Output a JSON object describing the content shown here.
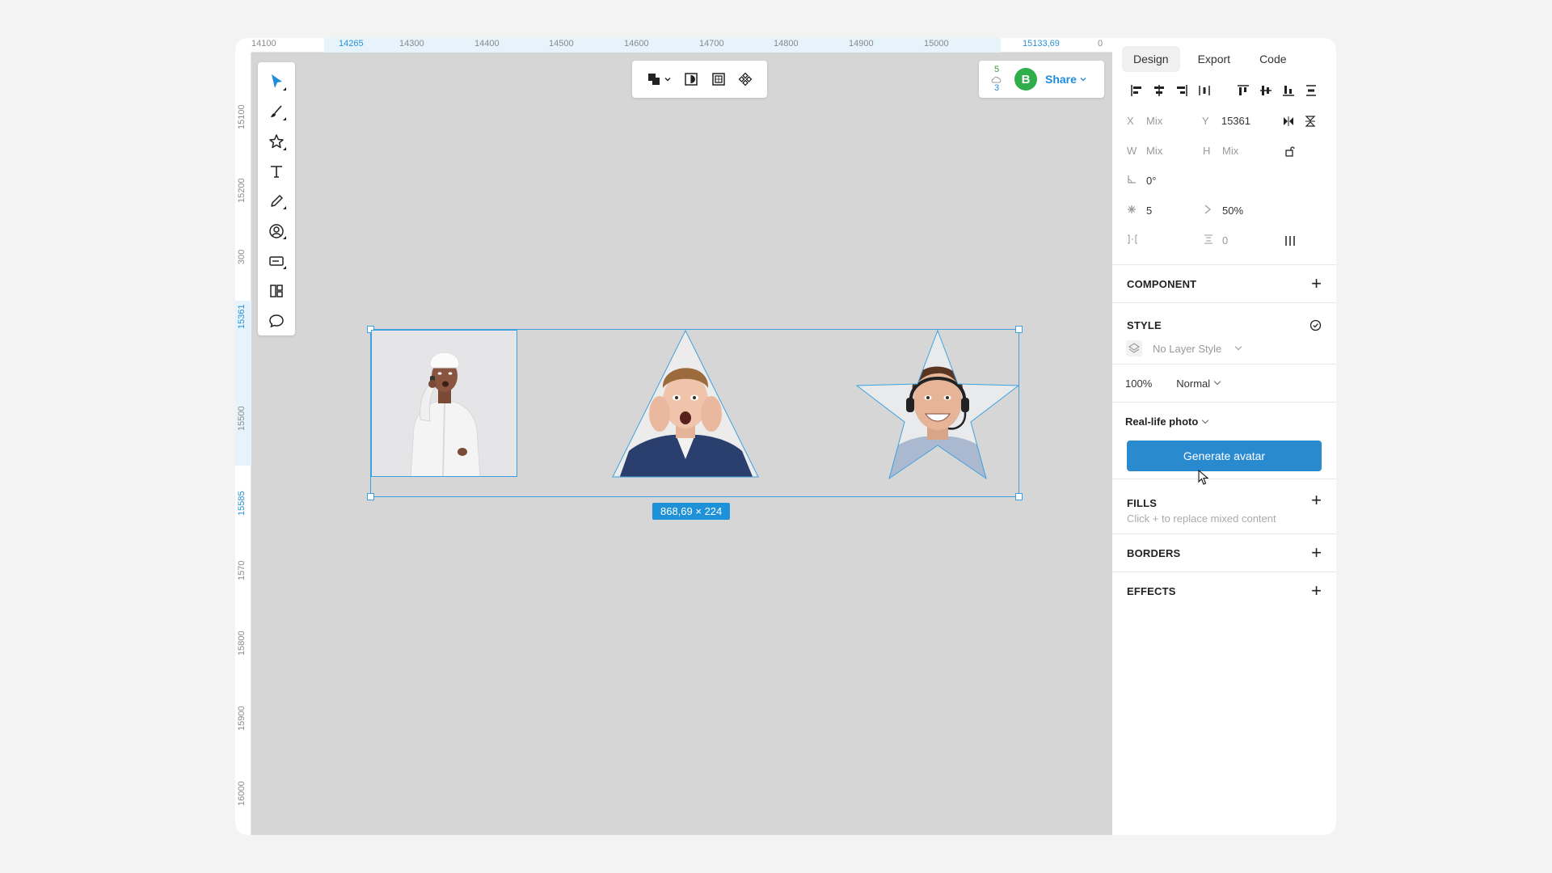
{
  "ruler": {
    "top_ticks": [
      "14100",
      "14265",
      "14300",
      "14400",
      "14500",
      "14600",
      "14700",
      "14800",
      "14900",
      "15000",
      "15133,69",
      "0"
    ],
    "left_ticks": [
      "15100",
      "15200",
      "300",
      "15361",
      "15500",
      "15585",
      "1570",
      "15800",
      "15900",
      "16000"
    ]
  },
  "selection": {
    "size_label": "868,69 × 224"
  },
  "share": {
    "viewers_up": "5",
    "viewers_down": "3",
    "avatar_letter": "B",
    "label": "Share"
  },
  "panel": {
    "tabs": [
      "Design",
      "Export",
      "Code"
    ],
    "x": {
      "label": "X",
      "value": "Mix"
    },
    "y": {
      "label": "Y",
      "value": "15361"
    },
    "w": {
      "label": "W",
      "value": "Mix"
    },
    "h": {
      "label": "H",
      "value": "Mix"
    },
    "rotation": "0°",
    "points": "5",
    "ratio": "50%",
    "spacing": "0",
    "component_title": "COMPONENT",
    "style_title": "STYLE",
    "layer_style": "No Layer Style",
    "opacity": "100%",
    "blend": "Normal",
    "avatar_kind": "Real-life photo",
    "generate_label": "Generate avatar",
    "fills_title": "FILLS",
    "fills_hint": "Click + to replace mixed content",
    "borders_title": "BORDERS",
    "effects_title": "EFFECTS"
  },
  "colors": {
    "accent": "#2a8ad0",
    "selection": "#3ea1de",
    "canvas": "#d6d6d6",
    "presence": "#2fae4b"
  }
}
